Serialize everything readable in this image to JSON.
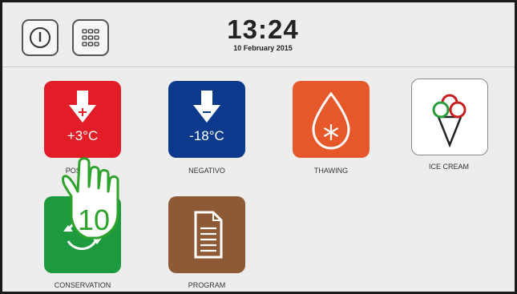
{
  "header": {
    "time": "13:24",
    "date": "10 February 2015",
    "power_icon": "power-icon",
    "menu_icon": "grid-menu-icon"
  },
  "apps": [
    {
      "label": "POSITIVO",
      "value": "+3°C",
      "color": "#e31d27",
      "icon": "down-arrow-plus-icon"
    },
    {
      "label": "NEGATIVO",
      "value": "-18°C",
      "color": "#0b3a8d",
      "icon": "down-arrow-minus-icon"
    },
    {
      "label": "THAWING",
      "color": "#e6582a",
      "icon": "water-drop-snowflake-icon"
    },
    {
      "label": "ICE CREAM",
      "color": "#ffffff",
      "icon": "ice-cream-cone-icon"
    },
    {
      "label": "CONSERVATION",
      "color": "#1d9a3d",
      "icon": "cycle-arrows-icon"
    },
    {
      "label": "PROGRAM",
      "color": "#8e5a35",
      "icon": "document-icon"
    }
  ],
  "overlay": {
    "step_number": "10",
    "icon": "tap-hand-icon",
    "color": "#2ea32c"
  }
}
